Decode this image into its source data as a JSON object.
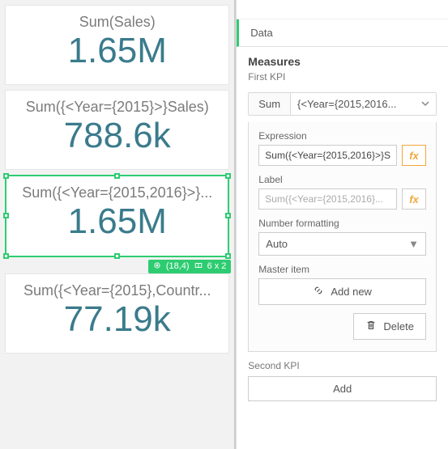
{
  "kpis": [
    {
      "label": "Sum(Sales)",
      "value": "1.65M"
    },
    {
      "label": "Sum({<Year={2015}>}Sales)",
      "value": "788.6k"
    },
    {
      "label": "Sum({<Year={2015,2016}>}...",
      "value": "1.65M"
    },
    {
      "label": "Sum({<Year={2015},Countr...",
      "value": "77.19k"
    }
  ],
  "selection_badge": {
    "position": "(18,4)",
    "size": "6 x 2"
  },
  "panel": {
    "tab": "Data",
    "measures_title": "Measures",
    "first_kpi_label": "First KPI",
    "aggregation": "Sum",
    "measure_expression_short": "{<Year={2015,2016...",
    "expression_label": "Expression",
    "expression_value": "Sum({<Year={2015,2016}>}S",
    "label_label": "Label",
    "label_placeholder": "Sum({<Year={2015,2016}...",
    "number_formatting_label": "Number formatting",
    "number_formatting_value": "Auto",
    "master_item_label": "Master item",
    "add_new_label": "Add new",
    "delete_label": "Delete",
    "second_kpi_label": "Second KPI",
    "add_label": "Add"
  }
}
